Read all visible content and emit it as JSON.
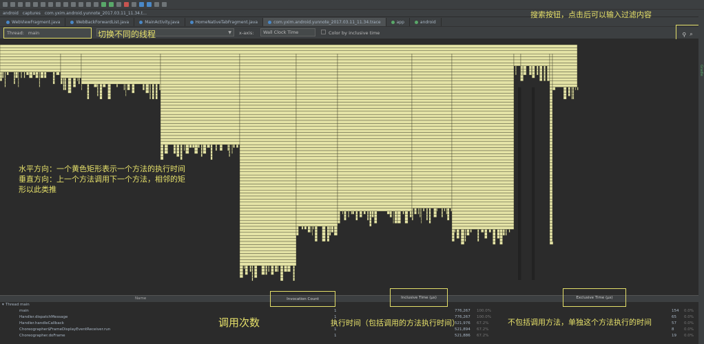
{
  "breadcrumbs": [
    "android",
    "captures",
    "com.yxim.android.yunnote_2017.03.11_11.34.t..."
  ],
  "tabs": [
    {
      "label": "WebViewFragment.java",
      "active": false,
      "dot": "blue"
    },
    {
      "label": "WebBackForwardList.java",
      "active": false,
      "dot": "blue"
    },
    {
      "label": "MainActivity.java",
      "active": false,
      "dot": "blue"
    },
    {
      "label": "HomeNativeTabFragment.java",
      "active": false,
      "dot": "blue"
    },
    {
      "label": "com.yxim.android.yunnote_2017.03.11_11.34.trace",
      "active": true,
      "dot": "blue"
    },
    {
      "label": "app",
      "active": false,
      "dot": "green"
    },
    {
      "label": "android",
      "active": false,
      "dot": "green"
    }
  ],
  "controls": {
    "thread_label": "Thread:",
    "thread_value": "main",
    "xaxis_label": "x-axis:",
    "xaxis_value": "Wall Clock Time",
    "color_label": "Color by inclusive time",
    "zoom_icon": "zoom-icon",
    "search_icon": "search-icon"
  },
  "right_strip_label": "Gradle",
  "table": {
    "col_name": "Name",
    "rows": [
      {
        "name": "Thread main",
        "count": "",
        "incl": "",
        "pct": "",
        "excl": "",
        "excl_pct": ""
      },
      {
        "name": "main",
        "count": "1",
        "incl": "776,267",
        "pct": "100.0%",
        "excl": "154",
        "excl_pct": "0.0%"
      },
      {
        "name": "Handler.dispatchMessage",
        "count": "1",
        "incl": "776,267",
        "pct": "100.0%",
        "excl": "65",
        "excl_pct": "0.0%"
      },
      {
        "name": "Handler.handleCallback",
        "count": "1",
        "incl": "521,976",
        "pct": "67.2%",
        "excl": "57",
        "excl_pct": "0.0%"
      },
      {
        "name": "Choreographer$FrameDisplayEventReceiver.run",
        "count": "1",
        "incl": "521,894",
        "pct": "67.2%",
        "excl": "8",
        "excl_pct": "0.0%"
      },
      {
        "name": "Choreographer.doFrame",
        "count": "1",
        "incl": "521,886",
        "pct": "67.2%",
        "excl": "19",
        "excl_pct": "0.0%"
      }
    ]
  },
  "overlays": {
    "invocation_count": "Invocation Count",
    "inclusive_time": "Inclusive Time (µs)",
    "exclusive_time": "Exclusive Time (µs)"
  },
  "annotations": {
    "search": "搜索按钮，点击后可以输入过滤内容",
    "switch_thread": "切换不同的线程",
    "explain_line1": "水平方向：一个黄色矩形表示一个方法的执行时间",
    "explain_line2": "垂直方向：上一个方法调用下一个方法，相邻的矩",
    "explain_line3": "形以此类推",
    "call_count": "调用次数",
    "inclusive_desc": "执行时间（包括调用的方法执行时间）",
    "exclusive_desc": "不包括调用方法，单独这个方法执行的时间"
  },
  "colors": {
    "flame_fill": "#e4e3a6",
    "flame_line": "#3a3a2a",
    "annotation": "#e6e06a",
    "background": "#2b2b2b"
  }
}
